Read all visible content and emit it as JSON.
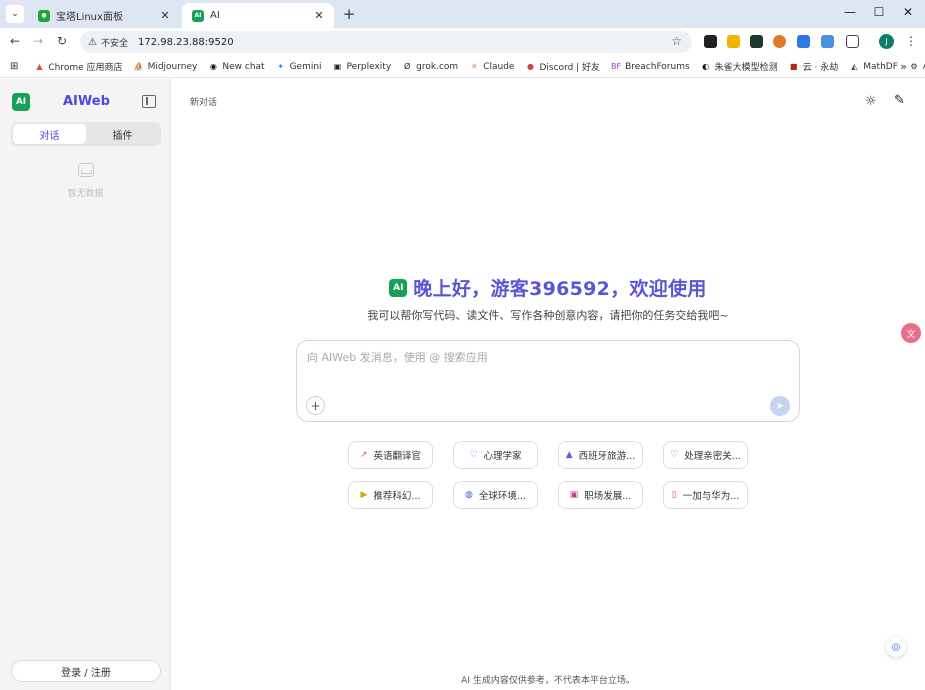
{
  "browser": {
    "tabs": [
      {
        "title": "宝塔Linux面板",
        "favicon_color": "#20a53a"
      },
      {
        "title": "AI",
        "favicon_color": "#18a058",
        "favicon_text": "AI"
      }
    ],
    "address": {
      "warning": "⚠",
      "insecure_label": "不安全",
      "url": "172.98.23.88:9520"
    },
    "profile_initial": "J",
    "bookmarks": [
      {
        "label": "Chrome 应用商店",
        "icon": "▲",
        "color": "#e44d26"
      },
      {
        "label": "Midjourney",
        "icon": "⛵",
        "color": "#555555"
      },
      {
        "label": "New chat",
        "icon": "◉",
        "color": "#111111"
      },
      {
        "label": "Gemini",
        "icon": "✦",
        "color": "#3b82f6"
      },
      {
        "label": "Perplexity",
        "icon": "▣",
        "color": "#222222"
      },
      {
        "label": "grok.com",
        "icon": "Ø",
        "color": "#222222"
      },
      {
        "label": "Claude",
        "icon": "✳",
        "color": "#d97757"
      },
      {
        "label": "Discord | 好友",
        "icon": "●",
        "color": "#d04a3c"
      },
      {
        "label": "BreachForums",
        "icon": "BF",
        "color": "#a03cd0"
      },
      {
        "label": "朱雀大模型检测",
        "icon": "◐",
        "color": "#111111"
      },
      {
        "label": "云 · 永劫",
        "icon": "■",
        "color": "#b3261e"
      },
      {
        "label": "MathDF",
        "icon": "◭",
        "color": "#444444"
      },
      {
        "label": "AIshare",
        "icon": "⚙",
        "color": "#333333"
      }
    ]
  },
  "sidebar": {
    "logo": "AI",
    "brand": "AIWeb",
    "tabs": [
      "对话",
      "插件"
    ],
    "empty_text": "暂无数据",
    "login_label": "登录 / 注册"
  },
  "main": {
    "title": "新对话",
    "greeting": "晚上好，游客396592，欢迎使用",
    "subtitle": "我可以帮你写代码、读文件、写作各种创意内容，请把你的任务交给我吧~",
    "input_placeholder": "向 AIWeb 发消息，使用 @ 搜索应用",
    "suggestions": [
      {
        "label": "英语翻译官",
        "icon": "↗",
        "color": "#e0489a"
      },
      {
        "label": "心理学家",
        "icon": "♡",
        "color": "#2f6fe8"
      },
      {
        "label": "西班牙旅游...",
        "icon": "▲",
        "color": "#6a5ae0"
      },
      {
        "label": "处理亲密关...",
        "icon": "♡",
        "color": "#2f6fe8"
      },
      {
        "label": "推荐科幻...",
        "icon": "▶",
        "color": "#d9a400"
      },
      {
        "label": "全球环境...",
        "icon": "◍",
        "color": "#3b5bdb"
      },
      {
        "label": "职场发展...",
        "icon": "▣",
        "color": "#c2399b"
      },
      {
        "label": "一加与华为...",
        "icon": "▯",
        "color": "#e0489a"
      }
    ],
    "disclaimer": "AI 生成内容仅供参考，不代表本平台立场。"
  },
  "colors": {
    "accent": "#4f46e5",
    "brand_green": "#18a058"
  }
}
